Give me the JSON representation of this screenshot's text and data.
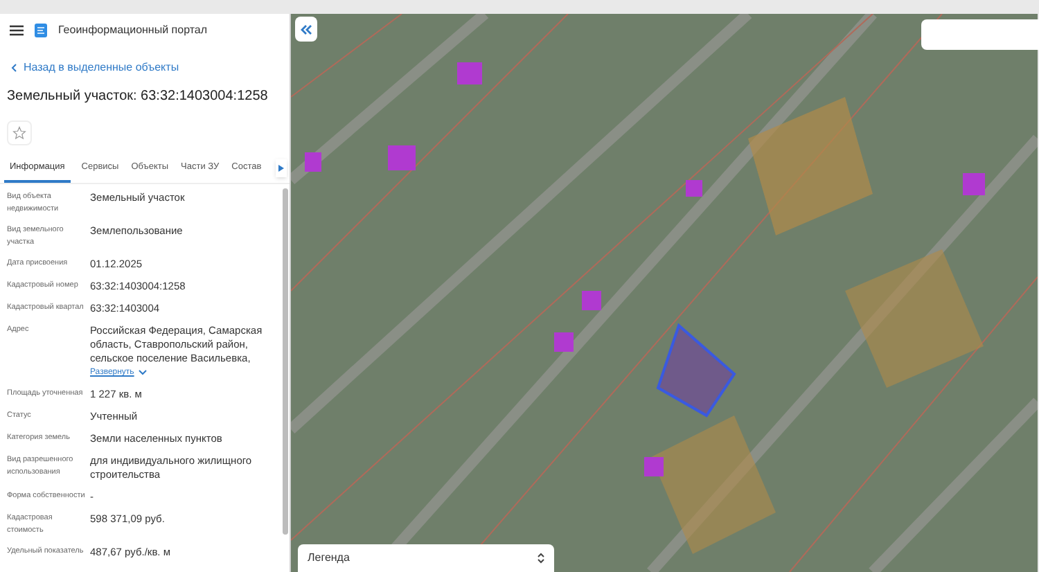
{
  "header": {
    "title": "Геоинформационный портал"
  },
  "back_link": "Назад в выделенные объекты",
  "page_title": "Земельный участок: 63:32:1403004:1258",
  "favorite": {
    "on": false
  },
  "tabs": [
    {
      "label": "Информация",
      "selected": true
    },
    {
      "label": "Сервисы",
      "selected": false
    },
    {
      "label": "Объекты",
      "selected": false
    },
    {
      "label": "Части ЗУ",
      "selected": false
    },
    {
      "label": "Состав",
      "selected": false
    }
  ],
  "fields": [
    {
      "label": "Вид объекта недвижимости",
      "value": "Земельный участок"
    },
    {
      "label": "Вид земельного участка",
      "value": "Землепользование"
    },
    {
      "label": "Дата присвоения",
      "value": "01.12.2025"
    },
    {
      "label": "Кадастровый номер",
      "value": "63:32:1403004:1258"
    },
    {
      "label": "Кадастровый квартал",
      "value": "63:32:1403004"
    },
    {
      "label": "Адрес",
      "value": "Российская Федерация, Самарская область, Ставропольский район, сельское поселение Васильевка,",
      "link": "Развернуть"
    },
    {
      "label": "Площадь уточненная",
      "value": "1 227 кв. м"
    },
    {
      "label": "Статус",
      "value": "Учтенный"
    },
    {
      "label": "Категория земель",
      "value": "Земли населенных пунктов"
    },
    {
      "label": "Вид разрешенного использования",
      "value": "для индивидуального жилищного строительства"
    },
    {
      "label": "Форма собственности",
      "value": "-"
    },
    {
      "label": "Кадастровая стоимость",
      "value": "598 371,09 руб."
    },
    {
      "label": "Удельный показатель",
      "value": "487,67 руб./кв. м"
    }
  ],
  "map": {
    "legend": "Легенда"
  }
}
